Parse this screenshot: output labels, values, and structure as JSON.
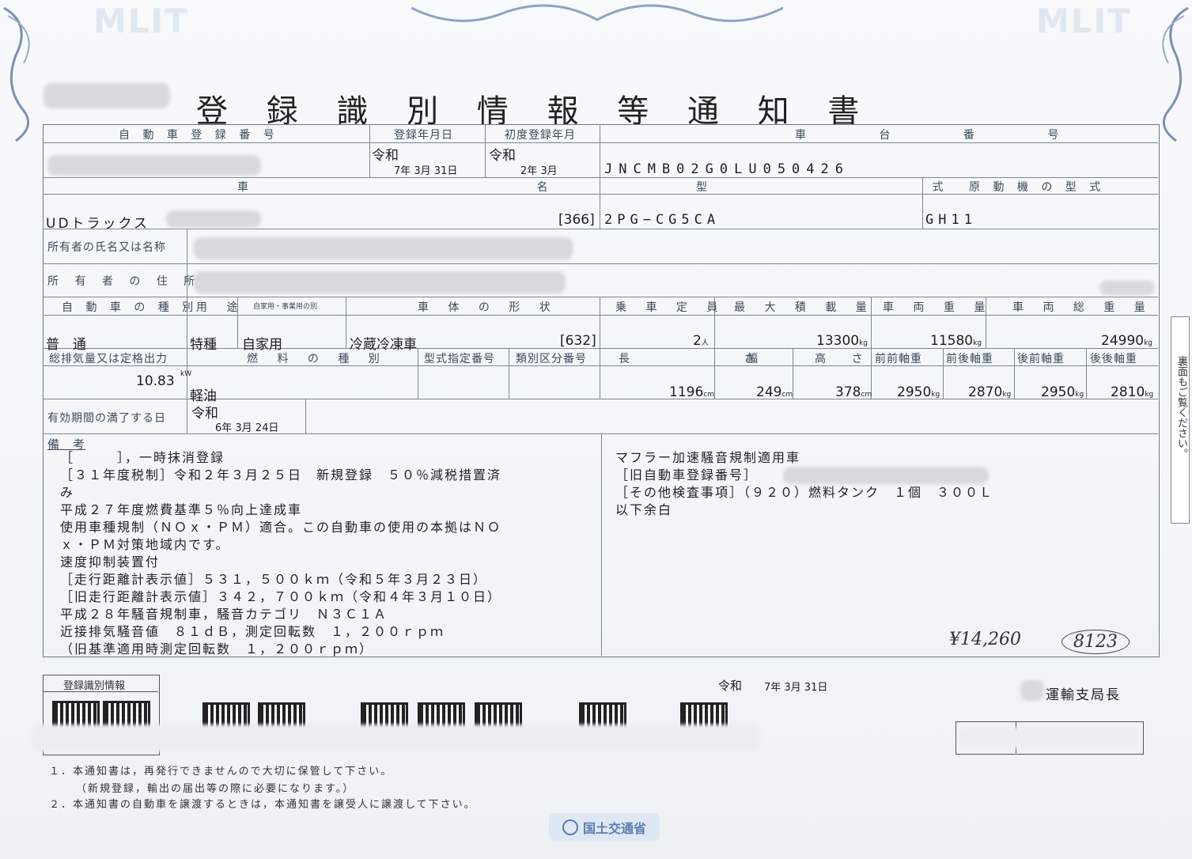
{
  "document": {
    "title": "登 録 識 別 情 報 等 通 知 書",
    "watermark": "MLIT",
    "ministry": "国土交通省"
  },
  "headers": {
    "reg_number": "自 動 車 登 録 番 号",
    "reg_date": "登録年月日",
    "first_reg": "初度登録年月",
    "chassis": "車 台 番 号",
    "car_name": "車 名",
    "model": "型 式",
    "engine_model": "原 動 機 の 型 式",
    "owner_name": "所有者の氏名又は名称",
    "owner_address": "所 有 者 の 住 所",
    "vehicle_type": "自 動 車 の 種 別",
    "usage": "用 途",
    "private_business": "自家用・事業用の別",
    "body_shape": "車 体 の 形 状",
    "capacity": "乗 車 定 員",
    "max_load": "最 大 積 載 量",
    "weight": "車 両 重 量",
    "gross_weight": "車 両 総 重 量",
    "displacement": "総排気量又は定格出力",
    "fuel": "燃 料 の 種 別",
    "type_designation": "型式指定番号",
    "category_number": "類別区分番号",
    "length": "長 さ",
    "width": "幅",
    "height": "高 さ",
    "ff_axle": "前前軸重",
    "fr_axle": "前後軸重",
    "rf_axle": "後前軸重",
    "rr_axle": "後後軸重",
    "expiry": "有効期間の満了する日",
    "remarks": "備　考"
  },
  "values": {
    "reg_era": "令和",
    "reg_date": "7年 3月 31日",
    "first_era": "令和",
    "first_date": "2年 3月",
    "chassis_number": "JNCMB02G0LU050426",
    "car_name": "UDトラックス",
    "car_code": "[366]",
    "model": "2PG−CG5CA",
    "engine_model": "GH11",
    "vehicle_type": "普　通",
    "usage": "特種",
    "private_business": "自家用",
    "body_shape": "冷蔵冷凍車",
    "body_code": "[632]",
    "capacity": "2",
    "capacity_unit": "人",
    "max_load": "13300",
    "weight": "11580",
    "gross_weight": "24990",
    "kg": "kg",
    "displacement": "10.83",
    "displacement_unit": "kW",
    "fuel": "軽油",
    "length": "1196",
    "width": "249",
    "height": "378",
    "cm": "cm",
    "ff_axle": "2950",
    "fr_axle": "2870",
    "rf_axle": "2950",
    "rr_axle": "2810",
    "expiry_era": "令和",
    "expiry_date": "6年 3月 24日"
  },
  "remarks_left": [
    "［　　　］，一時抹消登録",
    "［３１年度税制］令和２年３月２５日　新規登録　５０％減税措置済",
    "み",
    "平成２７年度燃費基準５％向上達成車",
    "使用車種規制（ＮＯｘ・ＰＭ）適合。この自動車の使用の本拠はＮＯ",
    "ｘ・ＰＭ対策地域内です。",
    "速度抑制装置付",
    "［走行距離計表示値］５３１，５００ｋｍ（令和５年３月２３日）",
    "［旧走行距離計表示値］３４２，７００ｋｍ（令和４年３月１０日）",
    "平成２８年騒音規制車，騒音カテゴリ　Ｎ３Ｃ１Ａ",
    "近接排気騒音値　８１ｄＢ，測定回転数　１，２００ｒｐｍ",
    "（旧基準適用時測定回転数　１，２００ｒｐｍ）"
  ],
  "remarks_right": [
    "マフラー加速騒音規制適用車",
    "［旧自動車登録番号］",
    "［その他検査事項］（９２０）燃料タンク　１個　３００Ｌ",
    "以下余白"
  ],
  "handwritten": {
    "price": "¥14,260",
    "code": "8123"
  },
  "footer": {
    "qr_box_label": "登録識別情報",
    "issue_era": "令和",
    "issue_date": "7年 3月 31日",
    "issuer": "運輸支局長",
    "note1": "１．本通知書は，再発行できませんので大切に保管して下さい。",
    "note1b": "（新規登録，輸出の届出等の際に必要になります。）",
    "note2": "２．本通知書の自動車を譲渡するときは，本通知書を譲受人に譲渡して下さい。",
    "side_note": "裏面もご覧ください。"
  }
}
